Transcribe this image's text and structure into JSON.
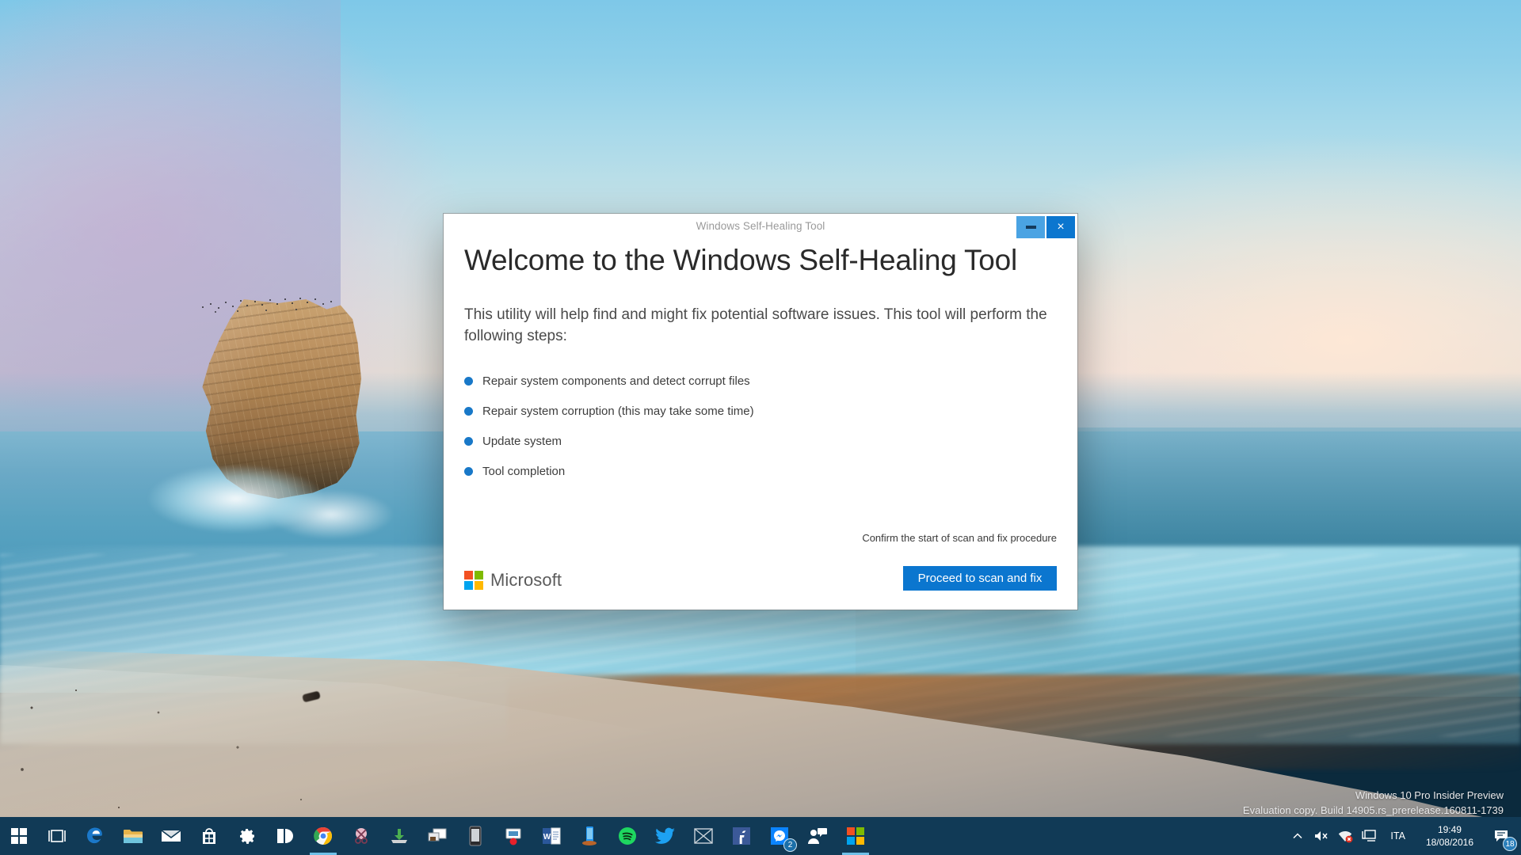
{
  "desktop": {
    "wallpaper_name": "coastal-sea-stack-wallpaper",
    "watermark": {
      "line1": "Windows 10 Pro Insider Preview",
      "line2": "Evaluation copy. Build 14905.rs_prerelease.160811-1739"
    }
  },
  "window": {
    "title": "Windows Self-Healing Tool",
    "controls": {
      "minimize_label": "Minimize",
      "close_label": "×"
    },
    "heading": "Welcome to the Windows Self-Healing Tool",
    "intro": "This utility will help find and might fix potential software issues. This tool will perform the following steps:",
    "steps": [
      "Repair system components and detect corrupt files",
      "Repair system corruption (this may take some time)",
      "Update system",
      "Tool completion"
    ],
    "footer": {
      "confirm_note": "Confirm the start of scan and fix procedure",
      "brand": "Microsoft",
      "cta_label": "Proceed to scan and fix"
    },
    "colors": {
      "accent": "#0b76cf",
      "minimize_bg": "#4aa3e3",
      "bullet": "#1878c8",
      "ms_red": "#f25022",
      "ms_green": "#7fba00",
      "ms_blue": "#00a4ef",
      "ms_yellow": "#ffb900"
    }
  },
  "taskbar": {
    "start": {
      "name": "start-button",
      "label": "Start"
    },
    "items": [
      {
        "icon": "task-view-icon",
        "label": "Task View",
        "active": false,
        "badge": null
      },
      {
        "icon": "edge-browser-icon",
        "label": "Microsoft Edge",
        "active": false,
        "badge": null
      },
      {
        "icon": "file-explorer-icon",
        "label": "File Explorer",
        "active": false,
        "badge": null
      },
      {
        "icon": "mail-icon",
        "label": "Mail",
        "active": false,
        "badge": null
      },
      {
        "icon": "store-icon",
        "label": "Microsoft Store",
        "active": false,
        "badge": null
      },
      {
        "icon": "settings-gear-icon",
        "label": "Settings",
        "active": false,
        "badge": null
      },
      {
        "icon": "windows-app-icon",
        "label": "Windows App",
        "active": false,
        "badge": null
      },
      {
        "icon": "chrome-browser-icon",
        "label": "Google Chrome",
        "active": true,
        "badge": null
      },
      {
        "icon": "snipping-tool-icon",
        "label": "Snipping Tool",
        "active": false,
        "badge": null
      },
      {
        "icon": "download-icon",
        "label": "Downloads",
        "active": false,
        "badge": null
      },
      {
        "icon": "remote-desktop-icon",
        "label": "Remote Desktop",
        "active": false,
        "badge": null
      },
      {
        "icon": "phone-icon",
        "label": "Phone",
        "active": false,
        "badge": null
      },
      {
        "icon": "screen-recorder-icon",
        "label": "Screen Recorder",
        "active": false,
        "badge": null
      },
      {
        "icon": "word-icon",
        "label": "Microsoft Word",
        "active": false,
        "badge": null
      },
      {
        "icon": "mobile-device-icon",
        "label": "Mobile Device",
        "active": false,
        "badge": null
      },
      {
        "icon": "spotify-icon",
        "label": "Spotify",
        "active": false,
        "badge": null
      },
      {
        "icon": "twitter-icon",
        "label": "Twitter",
        "active": false,
        "badge": null
      },
      {
        "icon": "placeholder-icon",
        "label": "Unknown App",
        "active": false,
        "badge": null
      },
      {
        "icon": "facebook-icon",
        "label": "Facebook",
        "active": false,
        "badge": null
      },
      {
        "icon": "messenger-icon",
        "label": "Messenger",
        "active": false,
        "badge": "2"
      },
      {
        "icon": "people-icon",
        "label": "People",
        "active": false,
        "badge": null
      },
      {
        "icon": "office-icon",
        "label": "Office",
        "active": true,
        "badge": null
      }
    ],
    "tray": {
      "show_hidden_icons": "show-hidden-icons-chevron",
      "volume": "volume-muted-icon",
      "network": "network-error-icon",
      "display": "display-icon",
      "language": "ITA",
      "time": "19:49",
      "date": "18/08/2016",
      "action_center": {
        "icon": "action-center-icon",
        "badge": "18"
      }
    }
  }
}
